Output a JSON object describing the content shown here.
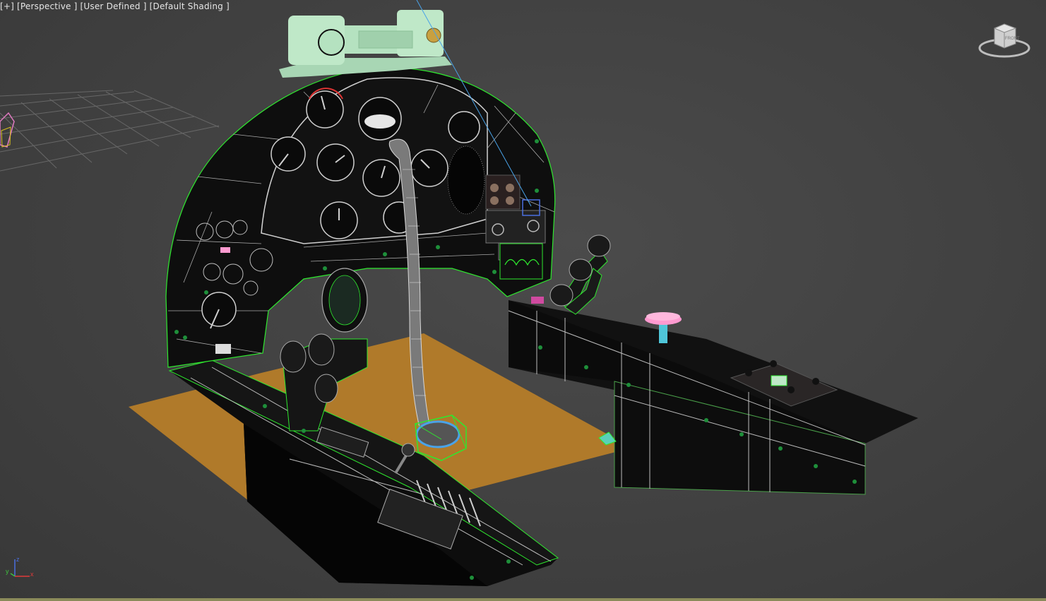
{
  "viewport": {
    "labels": [
      "[+]",
      "[Perspective ]",
      "[User Defined ]",
      "[Default Shading ]"
    ],
    "background": "#444444",
    "bottom_border_color": "#8b8b5a"
  },
  "viewcube": {
    "face_label": "FRONT",
    "icon": "viewcube-icon"
  },
  "axis_tripod": {
    "x_label": "x",
    "y_label": "y",
    "z_label": "z",
    "x_color": "#e03a3a",
    "y_color": "#3ec23e",
    "z_color": "#4a6fe0"
  },
  "scene": {
    "floor_color": "#b07a2a",
    "panel_color": "#0d0d0d",
    "wire_color": "#bfbfbf",
    "selection_color": "#2ee82e",
    "mount_color": "#bfe8c8",
    "pedal_color": "#ff9ad0",
    "pedal_stem_color": "#4fc6d9",
    "beam_color": "#4aa3e8"
  }
}
